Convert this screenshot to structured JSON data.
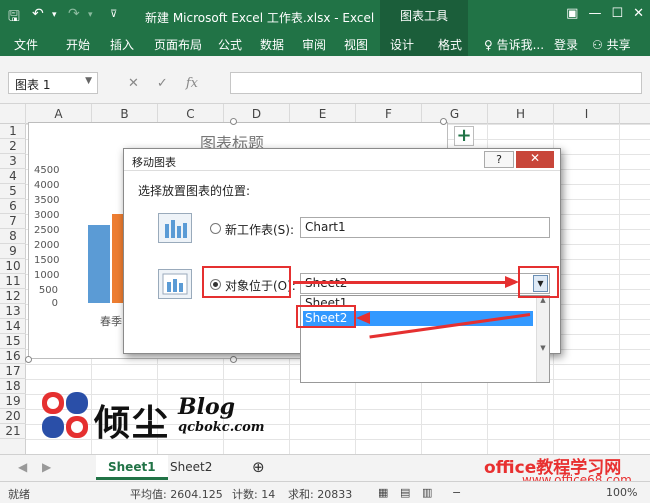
{
  "titlebar": {
    "title": "新建 Microsoft Excel 工作表.xlsx - Excel",
    "context_tab": "图表工具",
    "bg": "#217346"
  },
  "ribbon_tabs": [
    "文件",
    "开始",
    "插入",
    "页面布局",
    "公式",
    "数据",
    "审阅",
    "视图",
    "设计",
    "格式"
  ],
  "ribbon_right": {
    "tellme": "♀ 告诉我...",
    "signin": "登录",
    "share": "共享"
  },
  "formula_bar": {
    "name_box": "图表 1",
    "fx": "fx",
    "formula": ""
  },
  "columns": [
    "A",
    "B",
    "C",
    "D",
    "E",
    "F",
    "G",
    "H",
    "I"
  ],
  "rows": [
    "1",
    "2",
    "3",
    "4",
    "5",
    "6",
    "7",
    "8",
    "9",
    "10",
    "11",
    "12",
    "13",
    "14",
    "15",
    "16",
    "17",
    "18",
    "19",
    "20",
    "21"
  ],
  "chart": {
    "title": "图表标题",
    "y_ticks": [
      "4500",
      "4000",
      "3500",
      "3000",
      "2500",
      "2000",
      "1500",
      "1000",
      "500",
      "0"
    ],
    "category": "春季",
    "series_colors": [
      "#5b9bd5",
      "#ed7d31"
    ],
    "plus": "+"
  },
  "dialog": {
    "title": "移动图表",
    "help": "?",
    "close": "✕",
    "prompt": "选择放置图表的位置:",
    "new_sheet_label": "新工作表(S):",
    "new_sheet_value": "Chart1",
    "object_label": "对象位于(O):",
    "object_value": "Sheet2",
    "options": [
      "Sheet1",
      "Sheet2"
    ]
  },
  "watermark": {
    "cn": "倾尘",
    "blog": "Blog",
    "url": "qcbokc.com",
    "office": "office教程学习网",
    "office_url": "www.office68.com"
  },
  "sheet_tabs": [
    "Sheet1",
    "Sheet2"
  ],
  "status": {
    "mode": "就绪",
    "average": "平均值: 2604.125",
    "count": "计数: 14",
    "sum": "求和: 20833",
    "zoom": "100%"
  }
}
